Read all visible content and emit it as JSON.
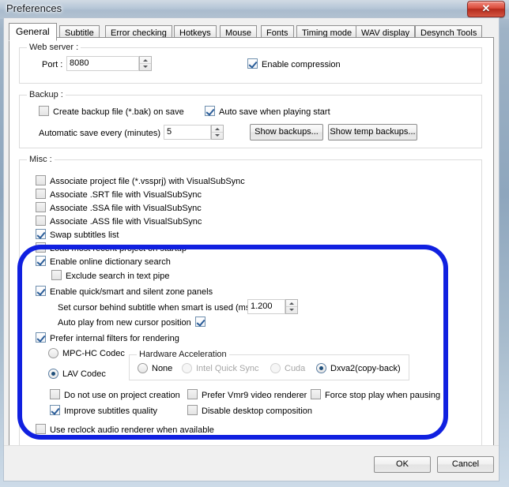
{
  "window": {
    "title": "Preferences",
    "close_label": "✕",
    "close_icon": "close-icon"
  },
  "tabs": [
    {
      "label": "General",
      "active": true
    },
    {
      "label": "Subtitle",
      "active": false
    },
    {
      "label": "Error checking",
      "active": false
    },
    {
      "label": "Hotkeys",
      "active": false
    },
    {
      "label": "Mouse",
      "active": false
    },
    {
      "label": "Fonts",
      "active": false
    },
    {
      "label": "Timing mode",
      "active": false
    },
    {
      "label": "WAV display",
      "active": false
    },
    {
      "label": "Desynch Tools",
      "active": false
    }
  ],
  "web_server": {
    "group_label": "Web server :",
    "port_label": "Port :",
    "port_value": "8080",
    "enable_compression_label": "Enable compression",
    "enable_compression_checked": true
  },
  "backup": {
    "group_label": "Backup :",
    "create_backup_label": "Create backup file (*.bak) on save",
    "create_backup_checked": false,
    "auto_save_label": "Auto save when playing start",
    "auto_save_checked": true,
    "interval_label": "Automatic save every (minutes) :",
    "interval_value": "5",
    "show_backups_label": "Show backups...",
    "show_temp_backups_label": "Show temp backups..."
  },
  "misc": {
    "group_label": "Misc :",
    "assoc_project_label": "Associate project file (*.vssprj) with VisualSubSync",
    "assoc_project_checked": false,
    "assoc_srt_label": "Associate .SRT file with VisualSubSync",
    "assoc_srt_checked": false,
    "assoc_ssa_label": "Associate .SSA file with VisualSubSync",
    "assoc_ssa_checked": false,
    "assoc_ass_label": "Associate .ASS file with VisualSubSync",
    "assoc_ass_checked": false,
    "swap_subtitles_label": "Swap subtitles list",
    "swap_subtitles_checked": true,
    "load_recent_label": "Load most recent project on startup",
    "load_recent_checked": false,
    "online_dict_label": "Enable online dictionary search",
    "online_dict_checked": true,
    "exclude_textpipe_label": "Exclude search in text pipe",
    "exclude_textpipe_checked": false,
    "quick_smart_label": "Enable quick/smart and silent zone panels",
    "quick_smart_checked": true,
    "set_cursor_label": "Set cursor behind subtitle when smart is used (ms)",
    "set_cursor_value": "1.200",
    "auto_play_label": "Auto play from new cursor position",
    "auto_play_checked": true,
    "prefer_internal_label": "Prefer internal filters for rendering",
    "prefer_internal_checked": true,
    "mpchc_codec_label": "MPC-HC Codec",
    "mpchc_codec_selected": false,
    "lav_codec_label": "LAV Codec",
    "lav_codec_selected": true,
    "hwaccel_group_label": "Hardware Acceleration",
    "hwaccel_options": [
      {
        "label": "None",
        "selected": false,
        "disabled": false
      },
      {
        "label": "Intel Quick Sync",
        "selected": false,
        "disabled": true
      },
      {
        "label": "Cuda",
        "selected": false,
        "disabled": true
      },
      {
        "label": "Dxva2(copy-back)",
        "selected": true,
        "disabled": false
      }
    ],
    "no_project_creation_label": "Do not use on project creation",
    "no_project_creation_checked": false,
    "prefer_vmr9_label": "Prefer Vmr9 video renderer",
    "prefer_vmr9_checked": false,
    "force_stop_label": "Force stop play when pausing",
    "force_stop_checked": false,
    "improve_quality_label": "Improve subtitles quality",
    "improve_quality_checked": true,
    "disable_desktop_label": "Disable desktop composition",
    "disable_desktop_checked": false,
    "use_reclock_label": "Use reclock audio renderer when available",
    "use_reclock_checked": false
  },
  "footer": {
    "ok_label": "OK",
    "cancel_label": "Cancel"
  },
  "annotation": {
    "highlight_color": "#1020e0",
    "shape": "rounded-rectangle"
  }
}
